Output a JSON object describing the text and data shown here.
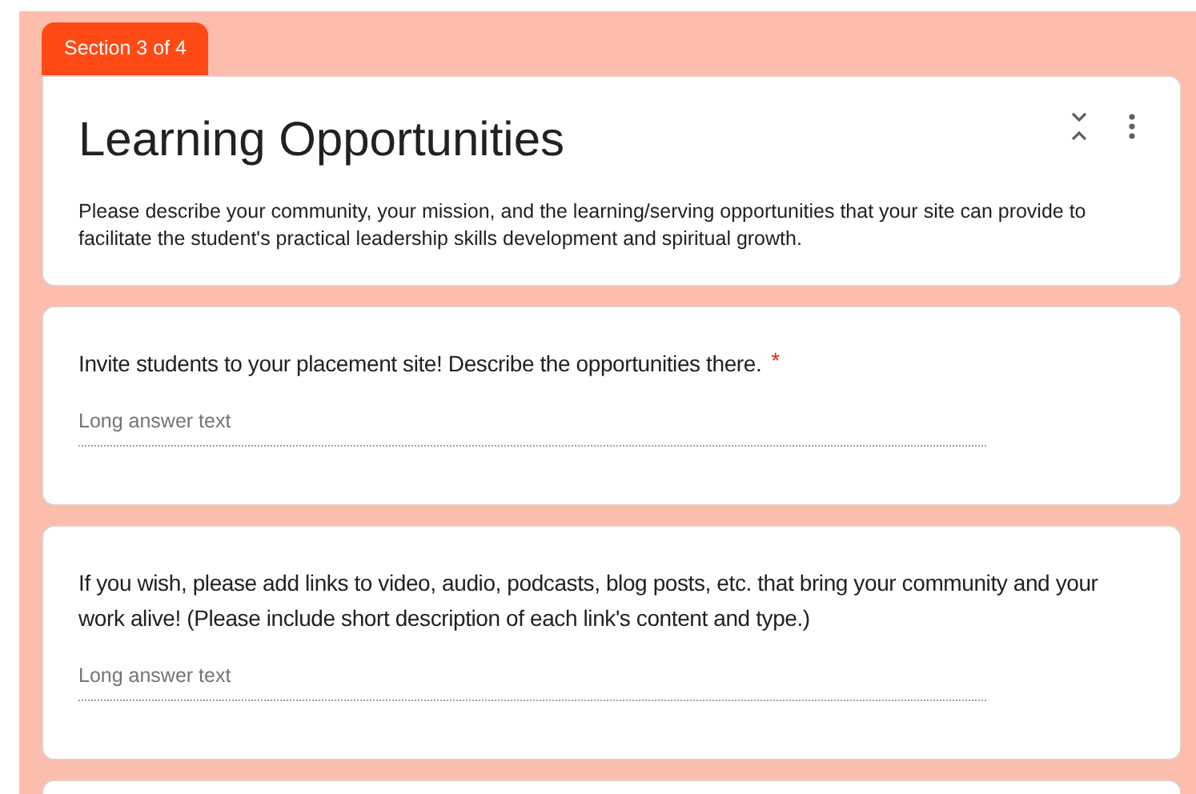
{
  "section_tab": "Section 3 of 4",
  "section": {
    "title": "Learning Opportunities",
    "description": "Please describe your community, your mission, and the learning/serving opportunities that your site can provide to facilitate the student's practical leadership skills development and spiritual growth."
  },
  "questions": [
    {
      "text": "Invite students to your placement site! Describe the opportunities there.",
      "required_mark": "*",
      "placeholder": "Long answer text"
    },
    {
      "text": "If you wish, please add links to video, audio, podcasts, blog posts, etc. that bring your community and your work alive! (Please include short description of each link's content and type.)",
      "placeholder": "Long answer text"
    }
  ]
}
